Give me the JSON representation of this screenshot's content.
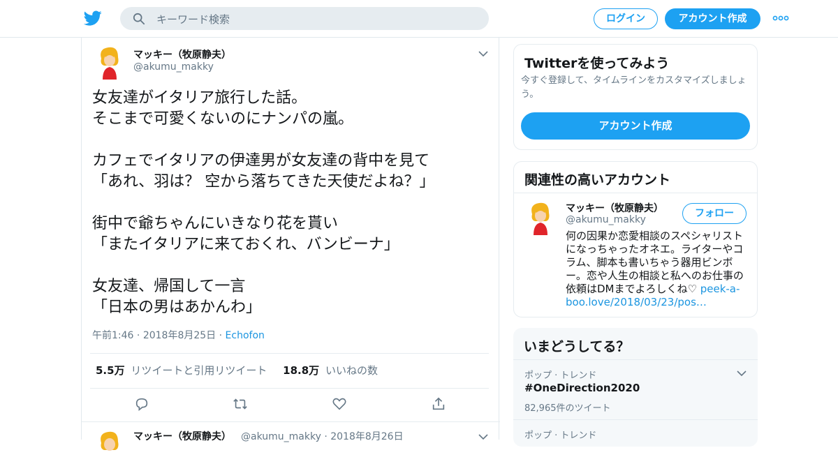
{
  "header": {
    "search_placeholder": "キーワード検索",
    "login_label": "ログイン",
    "signup_label": "アカウント作成",
    "brand_color": "#1da1f2"
  },
  "tweet": {
    "author_name": "マッキー（牧原静夫）",
    "author_handle": "@akumu_makky",
    "lines": [
      "女友達がイタリア旅行した話。",
      "そこまで可愛くないのにナンパの嵐。",
      "",
      "カフェでイタリアの伊達男が女友達の背中を見て",
      "「あれ、羽は？ 空から落ちてきた天使だよね？」",
      "",
      "街中で爺ちゃんにいきなり花を貰い",
      "「またイタリアに来ておくれ、バンビーナ」",
      "",
      "女友達、帰国して一言",
      "「日本の男はあかんわ」"
    ],
    "time": "午前1:46",
    "date": "2018年8月25日",
    "source": "Echofon",
    "retweet_count": "5.5万",
    "retweet_label": "リツイートと引用リツイート",
    "like_count": "18.8万",
    "like_label": "いいねの数"
  },
  "reply": {
    "author_name": "マッキー（牧原静夫）",
    "author_handle": "@akumu_makky",
    "date": "2018年8月26日"
  },
  "sidebar": {
    "try_title": "Twitterを使ってみよう",
    "try_sub": "今すぐ登録して、タイムラインをカスタマイズしましょう。",
    "try_button": "アカウント作成",
    "related_title": "関連性の高いアカウント",
    "related": {
      "name": "マッキー（牧原静夫）",
      "handle": "@akumu_makky",
      "follow_label": "フォロー",
      "bio": "何の因果か恋愛相談のスペシャリストになっちゃったオネエ。ライターやコラム、脚本も書いちゃう器用ビンボー。恋や人生の相談と私へのお仕事の依頼はDMまでよろしくね♡ ",
      "link": "peek-a-boo.love/2018/03/23/pos…"
    },
    "trends_title": "いまどうしてる？",
    "trends": [
      {
        "category": "ポップ · トレンド",
        "name": "#OneDirection2020",
        "count": "82,965件のツイート"
      },
      {
        "category": "ポップ · トレンド",
        "name": "",
        "count": ""
      }
    ]
  },
  "icons": [
    "twitter-bird-icon",
    "search-icon",
    "more-icon",
    "chevron-down-icon",
    "reply-icon",
    "retweet-icon",
    "like-icon",
    "share-icon"
  ]
}
